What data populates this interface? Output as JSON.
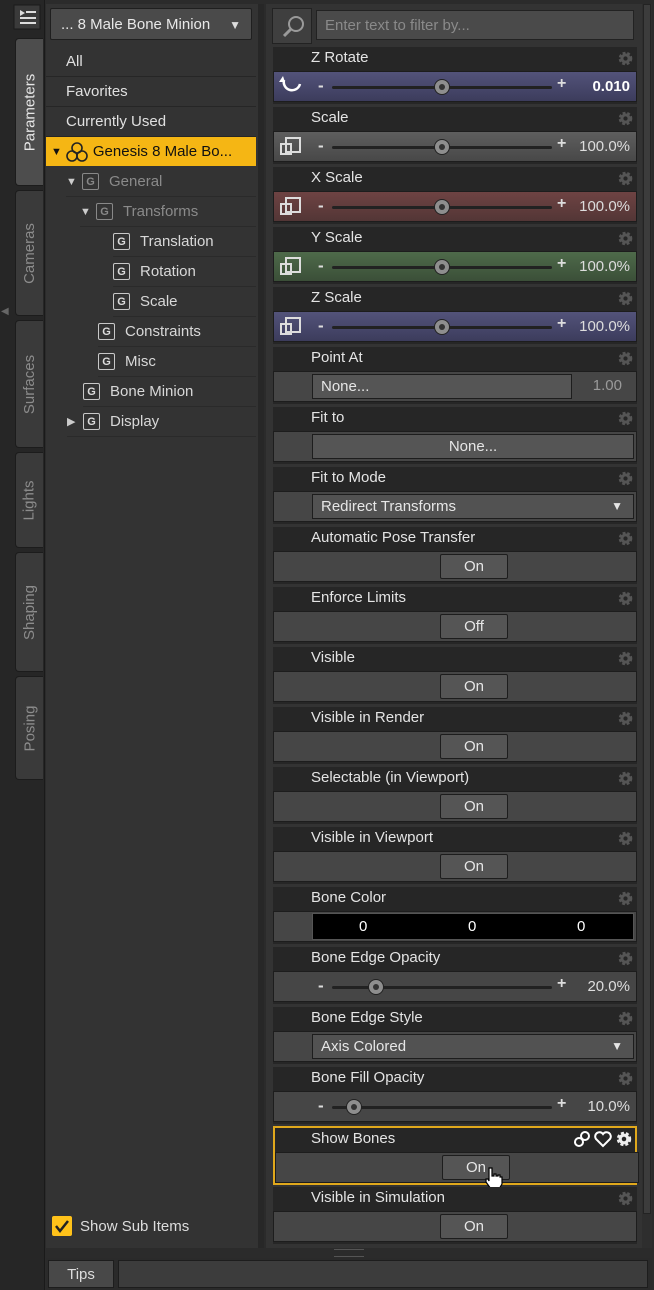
{
  "tabs": [
    {
      "label": "Parameters",
      "active": true
    },
    {
      "label": "Cameras"
    },
    {
      "label": "Surfaces"
    },
    {
      "label": "Lights"
    },
    {
      "label": "Shaping"
    },
    {
      "label": "Posing"
    }
  ],
  "node_selector": "... 8 Male Bone Minion",
  "filter": {
    "placeholder": "Enter text to filter by..."
  },
  "categories": [
    "All",
    "Favorites",
    "Currently Used"
  ],
  "tree": {
    "root": "Genesis 8 Male Bo...",
    "general": "General",
    "transforms": "Transforms",
    "translation": "Translation",
    "rotation": "Rotation",
    "scale": "Scale",
    "constraints": "Constraints",
    "misc": "Misc",
    "bone_minion": "Bone Minion",
    "display": "Display"
  },
  "show_sub_items": "Show Sub Items",
  "params": {
    "z_rotate": {
      "title": "Z Rotate",
      "value": "0.010",
      "slider": 0.5
    },
    "scale": {
      "title": "Scale",
      "value": "100.0%",
      "slider": 0.5
    },
    "x_scale": {
      "title": "X Scale",
      "value": "100.0%",
      "slider": 0.5
    },
    "y_scale": {
      "title": "Y Scale",
      "value": "100.0%",
      "slider": 0.5
    },
    "z_scale": {
      "title": "Z Scale",
      "value": "100.0%",
      "slider": 0.5
    },
    "point_at": {
      "title": "Point At",
      "button": "None...",
      "value": "1.00"
    },
    "fit_to": {
      "title": "Fit to",
      "button": "None..."
    },
    "fit_to_mode": {
      "title": "Fit to Mode",
      "value": "Redirect Transforms"
    },
    "auto_pose": {
      "title": "Automatic Pose Transfer",
      "value": "On"
    },
    "enforce_limits": {
      "title": "Enforce Limits",
      "value": "Off"
    },
    "visible": {
      "title": "Visible",
      "value": "On"
    },
    "visible_render": {
      "title": "Visible in Render",
      "value": "On"
    },
    "selectable": {
      "title": "Selectable (in Viewport)",
      "value": "On"
    },
    "visible_viewport": {
      "title": "Visible in Viewport",
      "value": "On"
    },
    "bone_color": {
      "title": "Bone Color",
      "r": "0",
      "g": "0",
      "b": "0"
    },
    "bone_edge_opacity": {
      "title": "Bone Edge Opacity",
      "value": "20.0%",
      "slider": 0.2
    },
    "bone_edge_style": {
      "title": "Bone Edge Style",
      "value": "Axis Colored"
    },
    "bone_fill_opacity": {
      "title": "Bone Fill Opacity",
      "value": "10.0%",
      "slider": 0.1
    },
    "show_bones": {
      "title": "Show Bones",
      "value": "On"
    },
    "visible_sim": {
      "title": "Visible in Simulation",
      "value": "On"
    }
  },
  "bottom": {
    "tips": "Tips"
  },
  "colors": {
    "accent": "#f5b614",
    "highlight_border": "#e0a81c"
  }
}
